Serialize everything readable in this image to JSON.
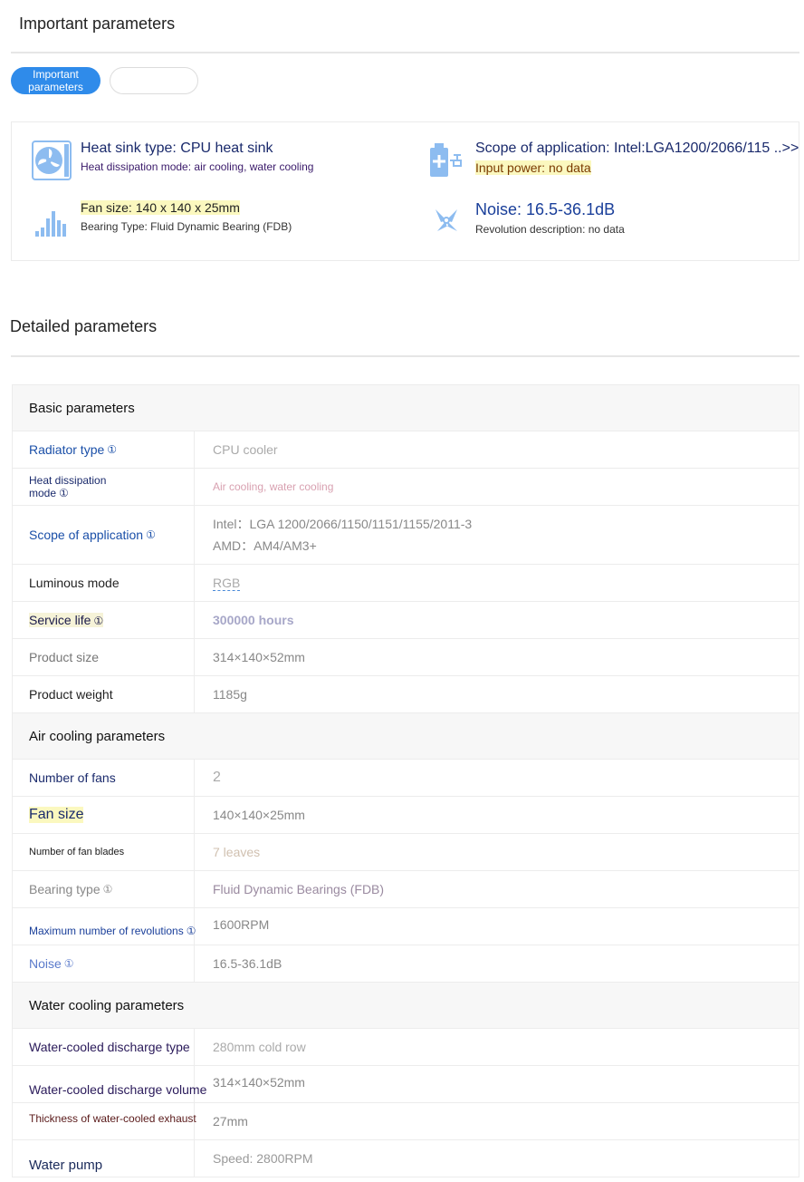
{
  "important": {
    "title": "Important parameters",
    "tabs": [
      "Important\nparameters",
      ""
    ],
    "summary": [
      {
        "main": "Heat sink type: CPU heat sink",
        "sub": "Heat dissipation mode: air cooling, water cooling",
        "icon": "heat-sink-icon"
      },
      {
        "main": "Scope of application: Intel:LGA1200/2066/115 ..>>",
        "sub": "Input power: no data",
        "icon": "power-plug-icon"
      },
      {
        "main": "Fan size: 140 x 140 x 25mm",
        "sub": "Bearing Type: Fluid Dynamic Bearing (FDB)",
        "icon": "bar-chart-icon"
      },
      {
        "main": "Noise: 16.5-36.1dB",
        "sub": "Revolution description: no data",
        "icon": "fan-blade-icon"
      }
    ]
  },
  "detailed": {
    "title": "Detailed parameters",
    "groups": [
      {
        "name": "Basic parameters",
        "rows": [
          {
            "key": "Radiator type",
            "value": "CPU cooler"
          },
          {
            "key": "Heat dissipation\nmode",
            "value": "Air cooling, water cooling"
          },
          {
            "key": "Scope of application",
            "value": "Intel：LGA 1200/2066/1150/1151/1155/2011-3",
            "value2": "AMD：AM4/AM3+"
          },
          {
            "key": "Luminous mode",
            "value": "RGB"
          },
          {
            "key": "Service life",
            "value": "300000 hours"
          },
          {
            "key": "Product size",
            "value": "314×140×52mm"
          },
          {
            "key": "Product weight",
            "value": "1185g"
          }
        ]
      },
      {
        "name": "Air cooling parameters",
        "rows": [
          {
            "key": "Number of fans",
            "value": "2"
          },
          {
            "key": "Fan size",
            "value": "140×140×25mm"
          },
          {
            "key": "Number of fan blades",
            "value": "7 leaves"
          },
          {
            "key": "Bearing type",
            "value": "Fluid Dynamic Bearings (FDB)"
          },
          {
            "key": "Maximum number of revolutions",
            "value": "1600RPM"
          },
          {
            "key": "Noise",
            "value": "16.5-36.1dB"
          }
        ]
      },
      {
        "name": "Water cooling parameters",
        "rows": [
          {
            "key": "Water-cooled discharge type",
            "value": "280mm cold row"
          },
          {
            "key": "Water-cooled discharge volume",
            "value": "314×140×52mm"
          },
          {
            "key": "Thickness of water-cooled exhaust",
            "value": "27mm"
          },
          {
            "key": "Water pump",
            "value": "Speed: 2800RPM"
          }
        ]
      }
    ]
  },
  "info_glyph": "①",
  "colors": {
    "accent": "#2f8bea",
    "icon": "#8dbcf0",
    "key_blue": "#1a3f9a",
    "key_navy": "#1a2a6c"
  }
}
